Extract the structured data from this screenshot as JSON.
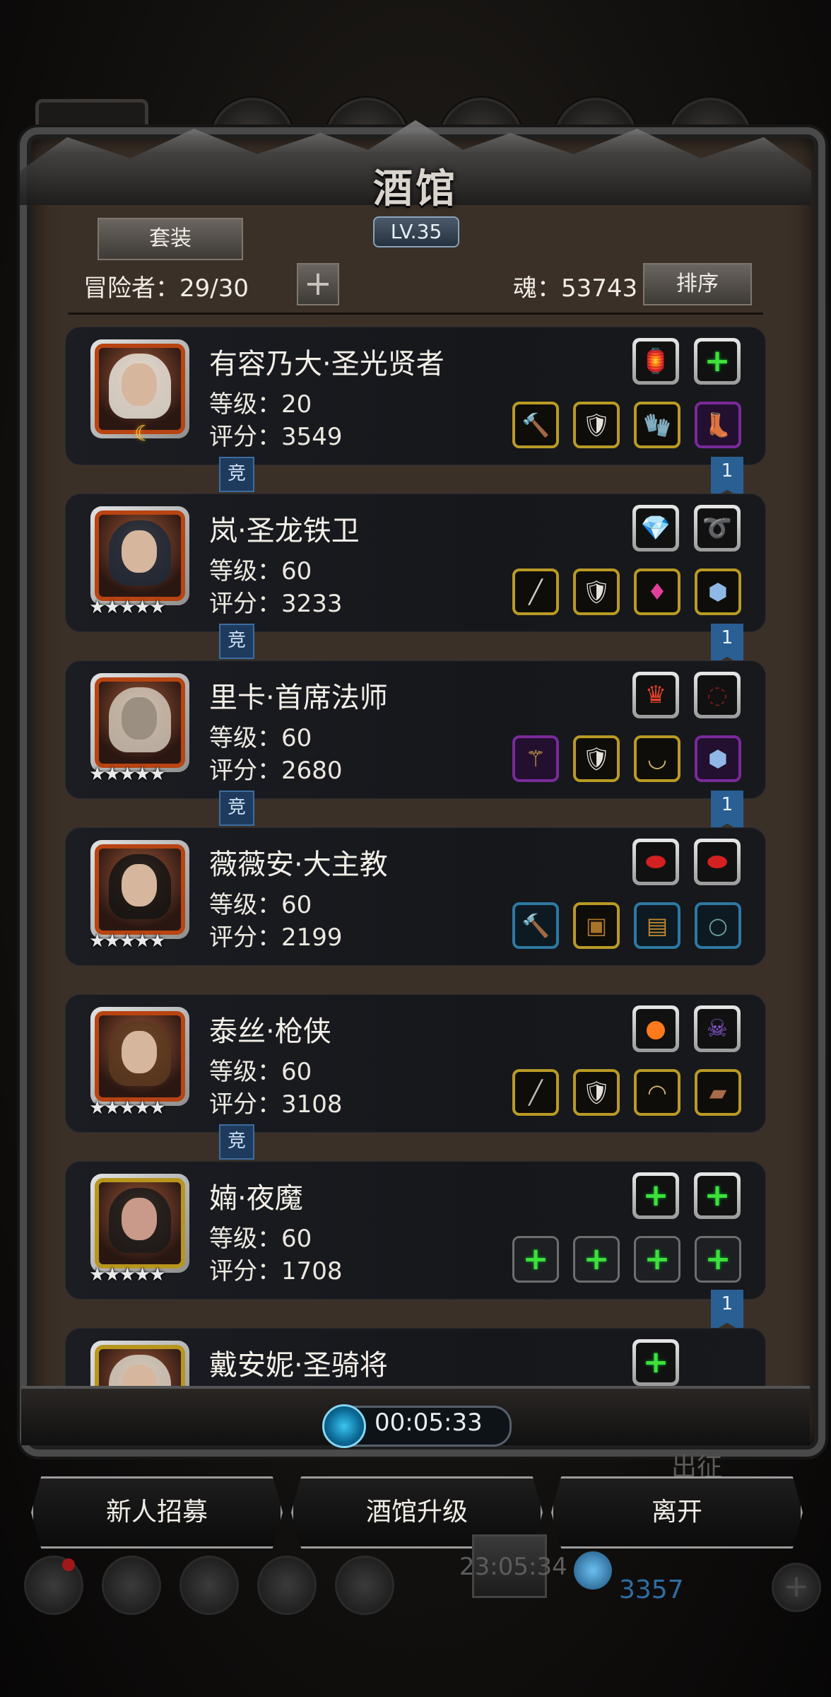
{
  "header": {
    "title": "酒馆",
    "level": "LV.35",
    "set_label": "套装",
    "adventurer_count": "冒险者：29/30",
    "add_symbol": "+",
    "soul": "魂：53743",
    "sort_label": "排序"
  },
  "competitive_tag": "竞",
  "rank_flag": "1",
  "heroes": [
    {
      "name": "有容乃大·圣光贤者",
      "level": "等级：20",
      "score": "评分：3549"
    },
    {
      "name": "岚·圣龙铁卫",
      "level": "等级：60",
      "score": "评分：3233",
      "stars": "★★★★★"
    },
    {
      "name": "里卡·首席法师",
      "level": "等级：60",
      "score": "评分：2680",
      "stars": "★★★★★"
    },
    {
      "name": "薇薇安·大主教",
      "level": "等级：60",
      "score": "评分：2199",
      "stars": "★★★★★"
    },
    {
      "name": "泰丝·枪侠",
      "level": "等级：60",
      "score": "评分：3108",
      "stars": "★★★★★"
    },
    {
      "name": "婻·夜魔",
      "level": "等级：60",
      "score": "评分：1708",
      "stars": "★★★★★"
    },
    {
      "name": "戴安妮·圣骑将"
    }
  ],
  "timer": "00:05:33",
  "actions": {
    "recruit": "新人招募",
    "upgrade": "酒馆升级",
    "leave": "离开"
  },
  "background_hud": {
    "expedition": "出征",
    "clock": "23:05:34",
    "gems": "3357",
    "plus": "+"
  }
}
